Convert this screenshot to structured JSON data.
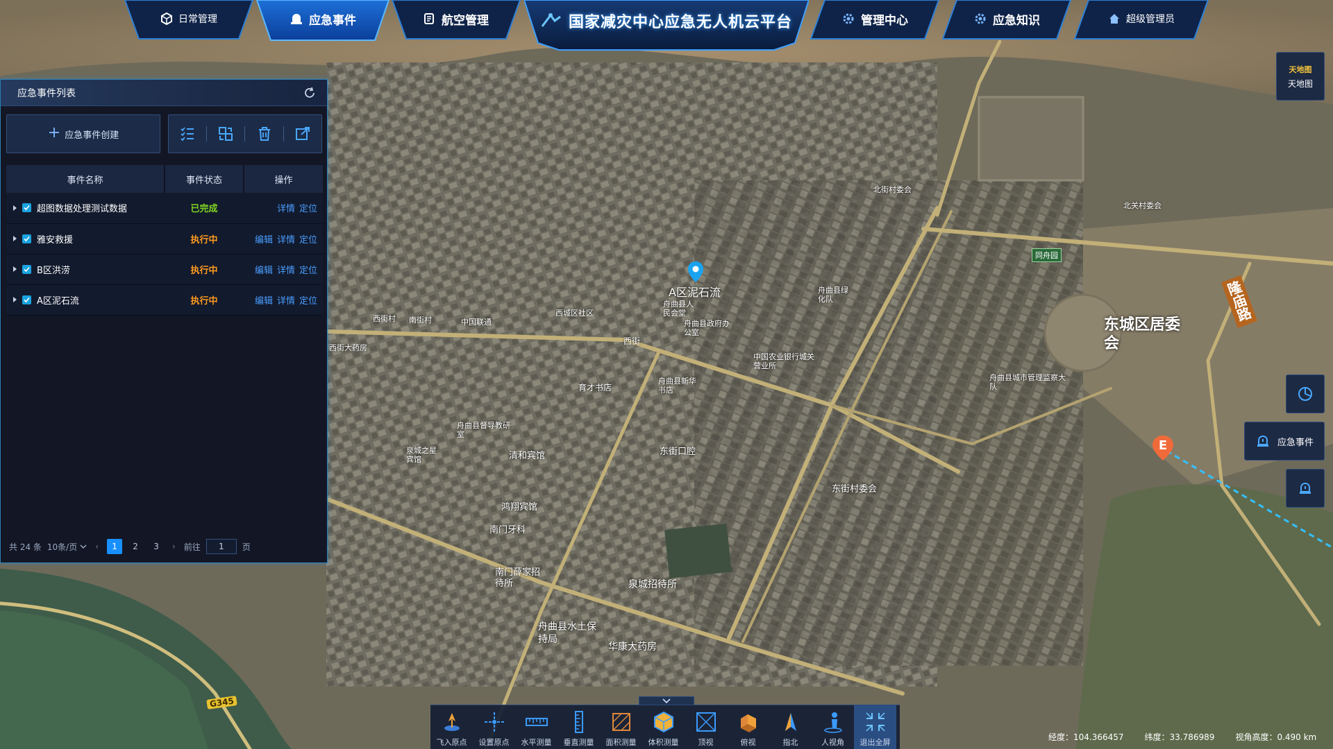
{
  "nav": {
    "tabs_left": [
      {
        "label": "日常管理",
        "icon": "cube-icon"
      },
      {
        "label": "应急事件",
        "icon": "alarm-icon",
        "active": true
      },
      {
        "label": "航空管理",
        "icon": "flight-doc-icon"
      }
    ],
    "title": "国家减灾中心应急无人机云平台",
    "tabs_right": [
      {
        "label": "管理中心",
        "icon": "gear-icon"
      },
      {
        "label": "应急知识",
        "icon": "gear-icon"
      },
      {
        "label": "超级管理员",
        "icon": "home-icon"
      }
    ]
  },
  "panel": {
    "title": "应急事件列表",
    "create_label": "应急事件创建",
    "columns": [
      "事件名称",
      "事件状态",
      "操作"
    ],
    "rows": [
      {
        "name": "超图数据处理测试数据",
        "status": "已完成",
        "ops": [
          "详情",
          "定位"
        ]
      },
      {
        "name": "雅安救援",
        "status": "执行中",
        "ops": [
          "编辑",
          "详情",
          "定位"
        ]
      },
      {
        "name": "B区洪涝",
        "status": "执行中",
        "ops": [
          "编辑",
          "详情",
          "定位"
        ]
      },
      {
        "name": "A区泥石流",
        "status": "执行中",
        "ops": [
          "编辑",
          "详情",
          "定位"
        ]
      }
    ],
    "pagination": {
      "total": "共 24 条",
      "page_size": "10条/页",
      "pages": [
        "1",
        "2",
        "3"
      ],
      "current_page": "1",
      "goto_label": "前往",
      "goto_value": "1",
      "page_unit": "页"
    }
  },
  "colors": {
    "status_done": "#7ed321",
    "status_running": "#ff9a1f",
    "accent": "#1890ff"
  },
  "map_labels": [
    {
      "text": "A区泥石流",
      "big": true
    },
    {
      "text": "舟曲县人民会堂"
    },
    {
      "text": "舟曲县政府办公室"
    },
    {
      "text": "中国农业银行城关营业所"
    },
    {
      "text": "舟曲县新华书店"
    },
    {
      "text": "育才书店"
    },
    {
      "text": "舟曲县督导教研室"
    },
    {
      "text": "泉城之星宾馆"
    },
    {
      "text": "清和宾馆"
    },
    {
      "text": "东街口腔"
    },
    {
      "text": "鸿翔宾馆"
    },
    {
      "text": "南门牙科"
    },
    {
      "text": "南门薛家招待所"
    },
    {
      "text": "泉城招待所"
    },
    {
      "text": "舟曲县水土保持局"
    },
    {
      "text": "华康大药房"
    },
    {
      "text": "东街村委会"
    },
    {
      "text": "西城区社区"
    },
    {
      "text": "中国联通"
    },
    {
      "text": "西街"
    },
    {
      "text": "西街村"
    },
    {
      "text": "南街村"
    },
    {
      "text": "西街大药房"
    },
    {
      "text": "东城区居委会"
    },
    {
      "text": "舟曲县城市管理监察大队"
    },
    {
      "text": "隆庙路"
    },
    {
      "text": "同舟园"
    },
    {
      "text": "舟曲县绿化队"
    },
    {
      "text": "北街村委会"
    },
    {
      "text": "北关村委会"
    },
    {
      "text": "G345"
    }
  ],
  "map_marker_e": "E",
  "side": {
    "basemap_logo": "天地图",
    "basemap_label": "天地图",
    "emergency_label": "应急事件"
  },
  "bottom_tools": [
    {
      "label": "飞入原点",
      "icon": "fly-in-icon"
    },
    {
      "label": "设置原点",
      "icon": "set-origin-icon"
    },
    {
      "label": "水平测量",
      "icon": "horizontal-measure-icon"
    },
    {
      "label": "垂直测量",
      "icon": "vertical-measure-icon"
    },
    {
      "label": "面积测量",
      "icon": "area-measure-icon"
    },
    {
      "label": "体积测量",
      "icon": "volume-measure-icon"
    },
    {
      "label": "顶视",
      "icon": "top-view-icon"
    },
    {
      "label": "俯视",
      "icon": "oblique-view-icon"
    },
    {
      "label": "指北",
      "icon": "compass-north-icon"
    },
    {
      "label": "人视角",
      "icon": "person-view-icon"
    },
    {
      "label": "退出全屏",
      "icon": "exit-fullscreen-icon",
      "active": true
    }
  ],
  "coords": {
    "lon": "经度：104.366457",
    "lat": "纬度：33.786989",
    "alt": "视角高度：0.490 km"
  }
}
